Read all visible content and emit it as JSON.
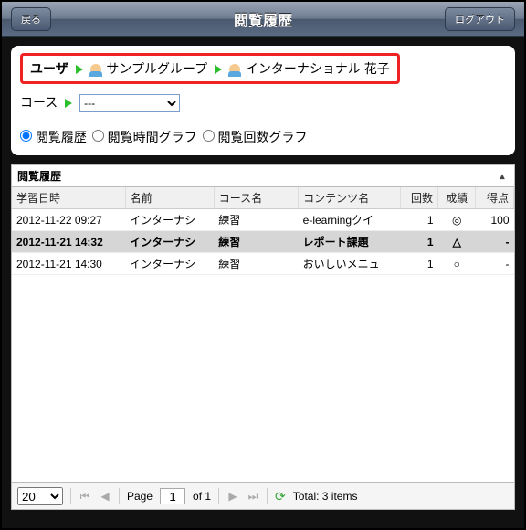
{
  "header": {
    "back": "戻る",
    "title": "閲覧履歴",
    "logout": "ログアウト"
  },
  "breadcrumb": {
    "label": "ユーザ",
    "group": "サンプルグループ",
    "user": "インターナショナル 花子"
  },
  "course": {
    "label": "コース",
    "selected": "---"
  },
  "radios": {
    "r1": "閲覧履歴",
    "r2": "閲覧時間グラフ",
    "r3": "閲覧回数グラフ"
  },
  "grid": {
    "title": "閲覧履歴",
    "headers": {
      "date": "学習日時",
      "name": "名前",
      "course": "コース名",
      "content": "コンテンツ名",
      "count": "回数",
      "result": "成績",
      "score": "得点"
    },
    "rows": [
      {
        "date": "2012-11-22 09:27",
        "name": "インターナシ",
        "course": "練習",
        "content": "e-learningクイ",
        "count": "1",
        "result": "◎",
        "score": "100"
      },
      {
        "date": "2012-11-21 14:32",
        "name": "インターナシ",
        "course": "練習",
        "content": "レポート課題",
        "count": "1",
        "result": "△",
        "score": "-"
      },
      {
        "date": "2012-11-21 14:30",
        "name": "インターナシ",
        "course": "練習",
        "content": "おいしいメニュ",
        "count": "1",
        "result": "○",
        "score": "-"
      }
    ]
  },
  "pager": {
    "size": "20",
    "page_lbl": "Page",
    "page": "1",
    "of": "of 1",
    "total": "Total: 3 items"
  }
}
